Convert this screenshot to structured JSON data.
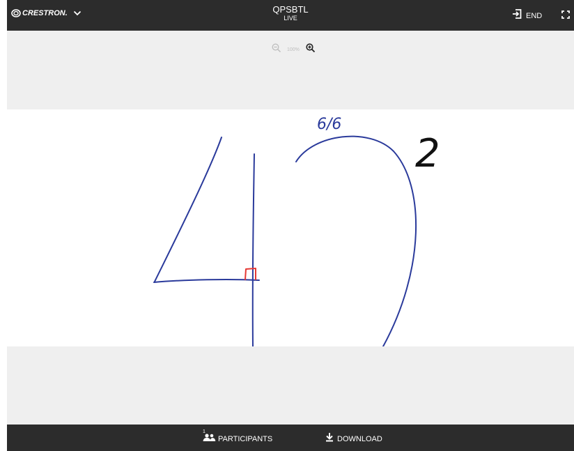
{
  "header": {
    "brand": "CRESTRON.",
    "brand_icon": "crestron-logo-icon",
    "menu_icon": "chevron-down-icon",
    "title": "QPSBTL",
    "status": "LIVE",
    "end_label": "END",
    "end_icon": "exit-icon",
    "fullscreen_icon": "fullscreen-icon"
  },
  "zoom": {
    "level": "100%",
    "zoom_out_icon": "zoom-out-icon",
    "zoom_in_icon": "zoom-in-icon"
  },
  "canvas": {
    "annotation_top": "6/6",
    "annotation_exponent": "2",
    "ink_colors": [
      "#2a3a9b",
      "#e53935",
      "#111111"
    ]
  },
  "footer": {
    "participants_label": "PARTICIPANTS",
    "participants_count": "1",
    "participants_icon": "participants-icon",
    "download_label": "DOWNLOAD",
    "download_icon": "download-icon"
  },
  "colors": {
    "bar_background": "#2c2c2c",
    "stage_background": "#efefef",
    "canvas_background": "#ffffff"
  }
}
